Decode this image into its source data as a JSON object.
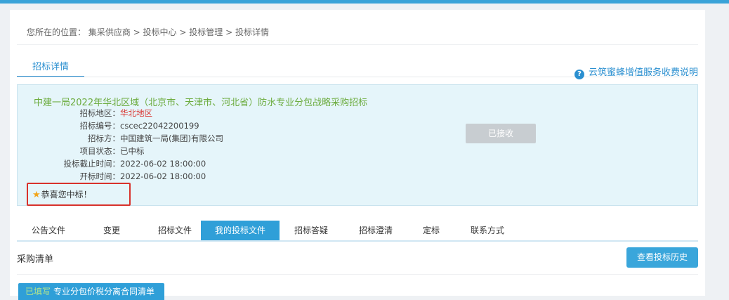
{
  "breadcrumb": {
    "prefix": "您所在的位置：",
    "items": [
      "集采供应商",
      "投标中心",
      "投标管理",
      "投标详情"
    ],
    "sep": " > "
  },
  "main_tab": "招标详情",
  "help_link": "云筑蜜蜂增值服务收费说明",
  "project": {
    "title": "中建一局2022年华北区域（北京市、天津市、河北省）防水专业分包战略采购招标",
    "fields": [
      {
        "label": "招标地区：",
        "value": "华北地区",
        "highlight": true
      },
      {
        "label": "招标编号：",
        "value": "cscec22042200199"
      },
      {
        "label": "招标方：",
        "value": "中国建筑一局(集团)有限公司"
      },
      {
        "label": "项目状态：",
        "value": "已中标"
      },
      {
        "label": "投标截止时间：",
        "value": "2022-06-02 18:00:00"
      },
      {
        "label": "开标时间：",
        "value": "2022-06-02 18:00:00"
      }
    ],
    "accept_button": "已接收",
    "congrats": "恭喜您中标！"
  },
  "subtabs": [
    "公告文件",
    "变更",
    "招标文件",
    "我的投标文件",
    "招标答疑",
    "招标澄清",
    "定标",
    "联系方式"
  ],
  "active_subtab": "我的投标文件",
  "list": {
    "title": "采购清单",
    "history_button": "查看投标历史",
    "item_tag": "已填写",
    "item_name": "专业分包价税分离合同清单"
  },
  "colors": {
    "accent": "#2f9fd8",
    "title_green": "#6bab3d",
    "alert_red": "#d9302c",
    "info_bg": "#e5f5fa"
  }
}
